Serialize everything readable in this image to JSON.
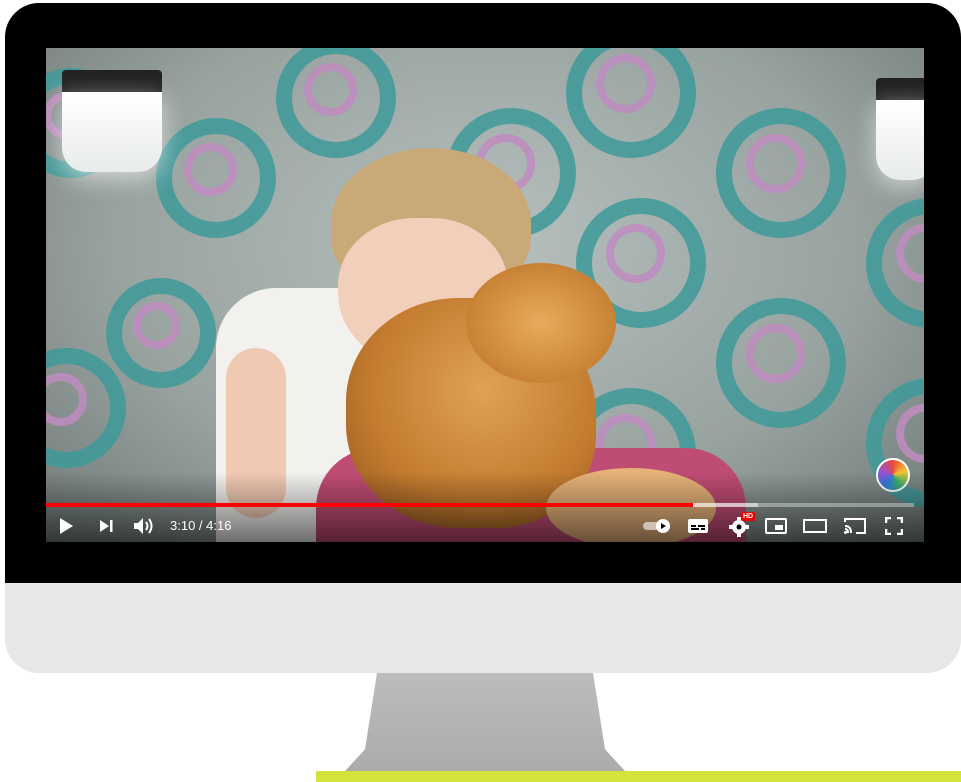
{
  "player": {
    "current_time": "3:10",
    "separator": " / ",
    "duration": "4:16",
    "progress_fraction": 0.745,
    "buffered_fraction": 0.82,
    "progress_color": "#ff0000",
    "quality_badge": "HD"
  },
  "icons": {
    "play": "play-icon",
    "next": "next-icon",
    "volume": "volume-icon",
    "autoplay": "autoplay-toggle-icon",
    "subtitles": "subtitles-icon",
    "settings": "gear-icon",
    "miniplayer": "miniplayer-icon",
    "theater": "theater-mode-icon",
    "cast": "cast-icon",
    "fullscreen": "fullscreen-icon"
  },
  "colors": {
    "bezel": "#000000",
    "chin": "#e8e8e8",
    "accent_bar": "#d4e23c"
  }
}
